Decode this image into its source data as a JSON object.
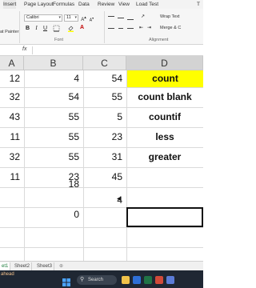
{
  "ribbon": {
    "tabs": [
      "Insert",
      "Page Layout",
      "Formulas",
      "Data",
      "Review",
      "View",
      "Load Test",
      "T"
    ],
    "active_tab": "Insert",
    "font_name": "Calibri",
    "font_size": "11",
    "wrap_text": "Wrap Text",
    "merge_center": "Merge & C",
    "format_painter": "at Painter",
    "group_font": "Font",
    "group_alignment": "Alignment"
  },
  "formula_bar": {
    "fx": "fx",
    "value": ""
  },
  "columns": [
    {
      "id": "A",
      "label": "A"
    },
    {
      "id": "B",
      "label": "B"
    },
    {
      "id": "C",
      "label": "C"
    },
    {
      "id": "D",
      "label": "D"
    }
  ],
  "rows": [
    {
      "a": "12",
      "b": "4",
      "c": "54",
      "d": "count"
    },
    {
      "a": "32",
      "b": "54",
      "c": "55",
      "d": "count blank"
    },
    {
      "a": "43",
      "b": "55",
      "c": "5",
      "d": "countif"
    },
    {
      "a": "11",
      "b": "55",
      "c": "23",
      "d": "less"
    },
    {
      "a": "32",
      "b": "55",
      "c": "31",
      "d": "greater"
    },
    {
      "a": "11",
      "b": "23",
      "c": "45",
      "d": ""
    }
  ],
  "extra_cells": {
    "b8": "18",
    "c9": "4",
    "b10": "0"
  },
  "sheets": [
    "et1",
    "Sheet2",
    "Sheet3"
  ],
  "active_sheet": "et1",
  "status": "ahead",
  "taskbar": {
    "search": "Search"
  },
  "colors": {
    "highlight": "#ffff00",
    "accent": "#217346"
  }
}
